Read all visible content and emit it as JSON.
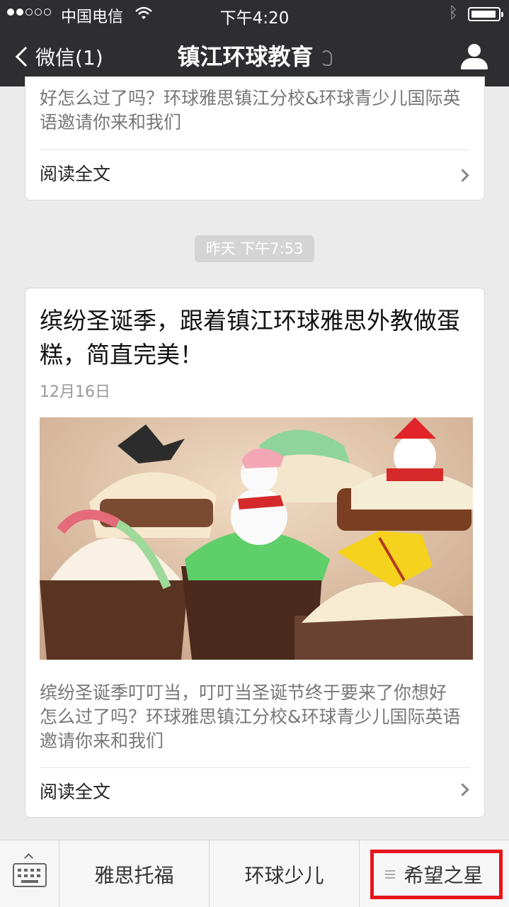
{
  "status_bar": {
    "carrier": "中国电信",
    "time": "下午4:20",
    "bluetooth": "bluetooth-icon",
    "wifi": "wifi-icon",
    "battery": "battery-icon"
  },
  "nav": {
    "back_label": "微信(1)",
    "title": "镇江环球教育",
    "profile_icon": "profile-icon"
  },
  "messages": [
    {
      "summary": "好怎么过了吗？环球雅思镇江分校&环球青少儿国际英语邀请你来和我们",
      "read_more": "阅读全文"
    },
    {
      "timestamp": "昨天 下午7:53",
      "headline": "缤纷圣诞季，跟着镇江环球雅思外教做蛋糕，简直完美！",
      "date": "12月16日",
      "summary": "缤纷圣诞季叮叮当，叮叮当圣诞节终于要来了你想好怎么过了吗？环球雅思镇江分校&环球青少儿国际英语邀请你来和我们",
      "read_more": "阅读全文"
    }
  ],
  "bottom_menu": {
    "keyboard_icon": "keyboard-icon",
    "items": [
      "雅思托福",
      "环球少儿",
      "希望之星"
    ]
  },
  "colors": {
    "header_bg": "#2e2e31",
    "page_bg": "#ebebeb",
    "highlight": "#e8141b"
  }
}
